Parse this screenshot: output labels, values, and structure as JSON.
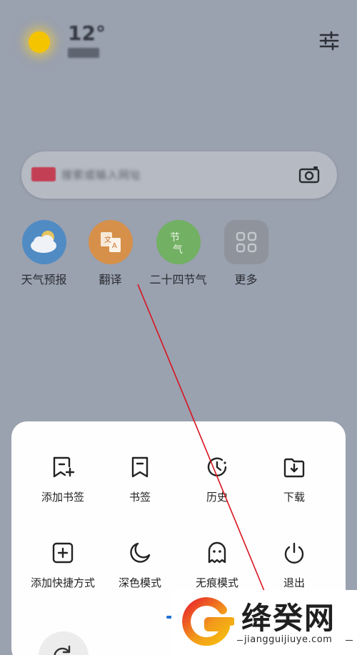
{
  "header": {
    "temperature": "12°",
    "city": "",
    "weather_icon": "sun-icon",
    "settings_icon": "sliders-icon"
  },
  "search": {
    "placeholder": "搜索或输入网址",
    "camera_icon": "camera-icon"
  },
  "apps": [
    {
      "label": "天气预报",
      "icon": "cloud-icon",
      "color": "#3a8fe0"
    },
    {
      "label": "翻译",
      "icon": "translate-icon",
      "color": "#f08c28"
    },
    {
      "label": "二十四节气",
      "icon": "solar-term-icon",
      "color": "#5fb84a"
    },
    {
      "label": "更多",
      "icon": "grid-icon",
      "color": "#8d93a0"
    }
  ],
  "menu": {
    "row1": [
      {
        "label": "添加书签",
        "icon": "add-bookmark-icon"
      },
      {
        "label": "书签",
        "icon": "bookmark-icon"
      },
      {
        "label": "历史",
        "icon": "history-icon"
      },
      {
        "label": "下载",
        "icon": "download-icon"
      }
    ],
    "row2": [
      {
        "label": "添加快捷方式",
        "icon": "add-shortcut-icon"
      },
      {
        "label": "深色模式",
        "icon": "moon-icon"
      },
      {
        "label": "无痕模式",
        "icon": "ghost-icon"
      },
      {
        "label": "退出",
        "icon": "power-icon"
      }
    ],
    "bottom_icon": "rotate-icon"
  },
  "watermark": {
    "title": "绛癸网",
    "url": "jiangguijiuye.com"
  }
}
